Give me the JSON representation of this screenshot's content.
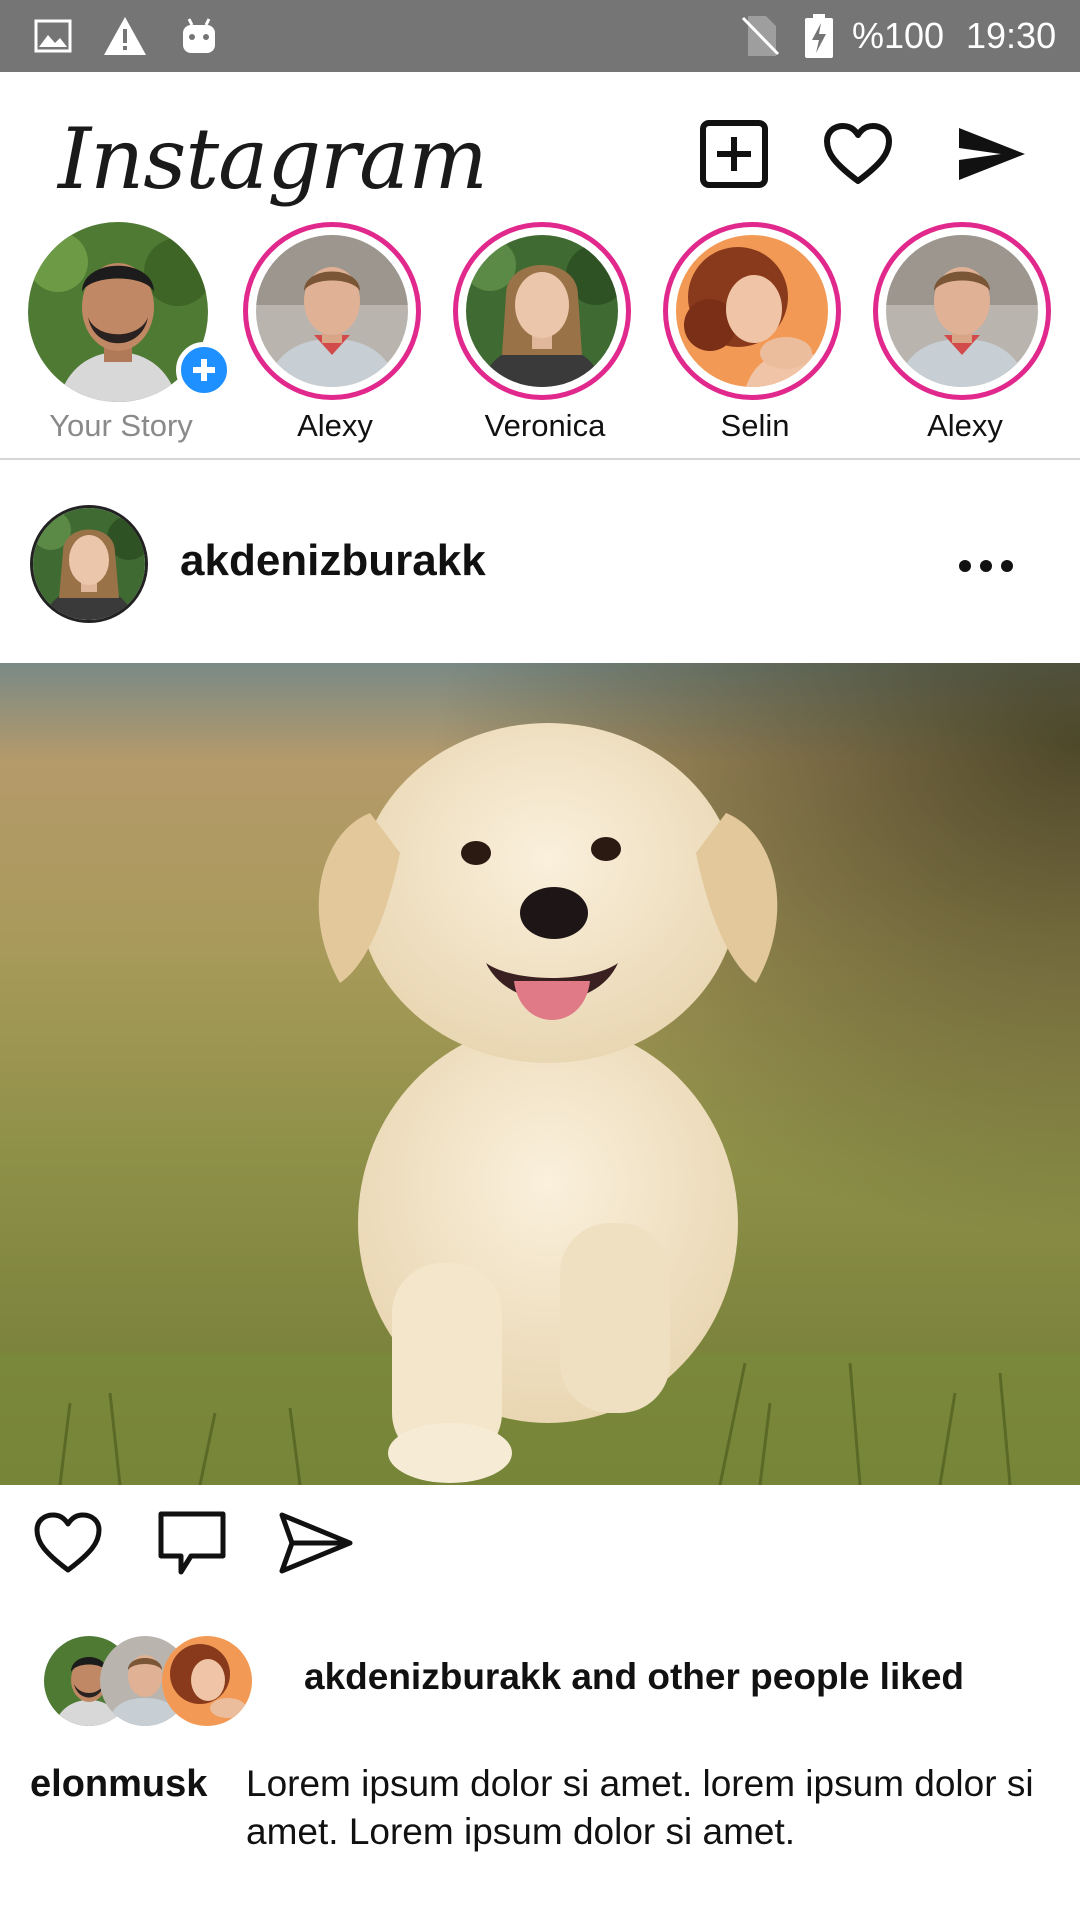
{
  "status_bar": {
    "battery": "%100",
    "time": "19:30",
    "icons": [
      "gallery-icon",
      "warning-icon",
      "android-icon",
      "no-sim-icon",
      "battery-charging-icon"
    ]
  },
  "header": {
    "logo": "Instagram",
    "actions": [
      "new-post-icon",
      "heart-icon",
      "send-icon"
    ]
  },
  "stories": [
    {
      "name": "Your Story",
      "own": true
    },
    {
      "name": "Alexy"
    },
    {
      "name": "Veronica"
    },
    {
      "name": "Selin"
    },
    {
      "name": "Alexy"
    }
  ],
  "post": {
    "username": "akdenizburakk",
    "likes_text": "akdenizburakk and other people liked",
    "caption_user": "elonmusk",
    "caption": "Lorem ipsum dolor si amet. lorem ipsum dolor si amet. Lorem ipsum dolor si amet.",
    "actions": [
      "heart-icon",
      "comment-icon",
      "share-icon"
    ]
  },
  "colors": {
    "status_bar": "#757575",
    "story_ring": "#e1288c",
    "add_badge": "#1e90ff"
  }
}
